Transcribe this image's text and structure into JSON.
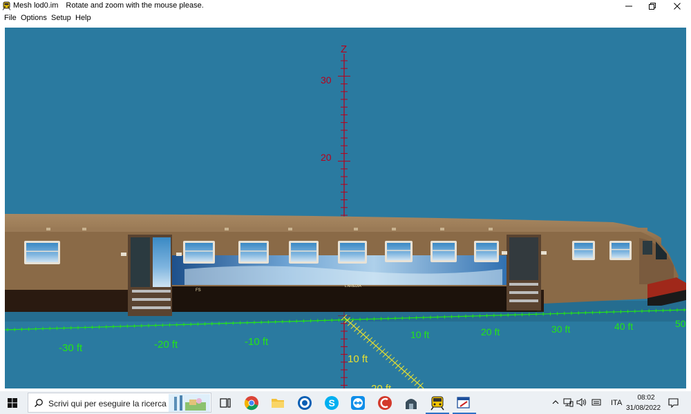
{
  "window": {
    "app_icon": "train-icon",
    "title": "Mesh lod0.im",
    "hint": "Rotate and zoom with the mouse please."
  },
  "menu": {
    "items": [
      "File",
      "Options",
      "Setup",
      "Help"
    ]
  },
  "viewport": {
    "background": "#2a7aa0",
    "z_axis": {
      "label": "Z",
      "ticks": [
        "30",
        "20"
      ],
      "color": "#b8001a"
    },
    "x_axis": {
      "color": "#24e614",
      "labels_left": [
        "-30 ft",
        "-20 ft",
        "-10 ft"
      ],
      "labels_right": [
        "10 ft",
        "20 ft",
        "30 ft",
        "40 ft",
        "50"
      ]
    },
    "y_axis": {
      "color": "#e8e030",
      "labels": [
        "10 ft",
        "20 ft"
      ]
    },
    "railcar": {
      "body_color": "#8a6a47",
      "livery_small_text_1": "FS",
      "livery_small_text_2": "L'ARIEDIA"
    }
  },
  "taskbar": {
    "start_icon": "windows-logo-icon",
    "search_placeholder": "Scrivi qui per eseguire la ricerca",
    "pinned": [
      "task-view-icon",
      "chrome-icon",
      "file-explorer-icon",
      "outlook-icon",
      "skype-icon",
      "teamviewer-icon",
      "ccleaner-icon",
      "app-icon",
      "train-app-icon",
      "editor-app-icon"
    ],
    "tray": {
      "language": "ITA",
      "time": "08:02",
      "date": "31/08/2022"
    }
  }
}
